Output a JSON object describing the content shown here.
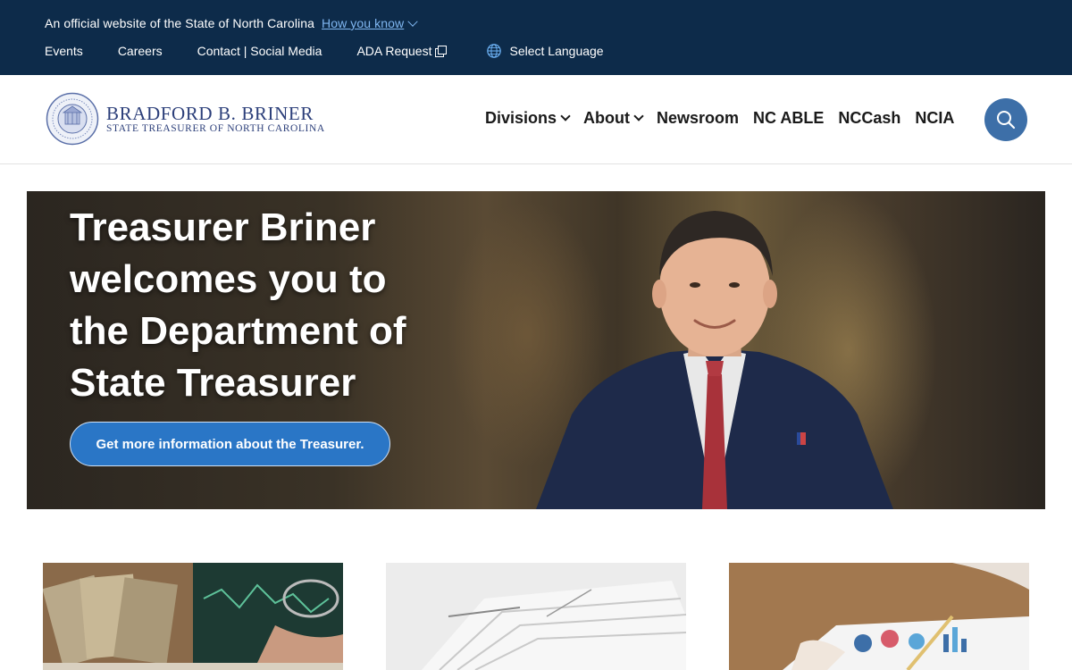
{
  "banner": {
    "official_text": "An official website of the State of North Carolina",
    "how_you_know": "How you know"
  },
  "utility_nav": {
    "items": [
      {
        "label": "Events"
      },
      {
        "label": "Careers"
      },
      {
        "label": "Contact | Social Media"
      },
      {
        "label": "ADA Request"
      }
    ],
    "language_label": "Select Language"
  },
  "header": {
    "logo_name": "BRADFORD B. BRINER",
    "logo_subtitle": "STATE TREASURER OF NORTH CAROLINA",
    "nav": [
      {
        "label": "Divisions",
        "has_dropdown": true
      },
      {
        "label": "About",
        "has_dropdown": true
      },
      {
        "label": "Newsroom",
        "has_dropdown": false
      },
      {
        "label": "NC ABLE",
        "has_dropdown": false
      },
      {
        "label": "NCCash",
        "has_dropdown": false
      },
      {
        "label": "NCIA",
        "has_dropdown": false
      }
    ],
    "search_icon": "search-icon"
  },
  "hero": {
    "title": "Treasurer Briner welcomes you to the Department of State Treasurer",
    "cta_label": "Get more information about the Treasurer."
  },
  "colors": {
    "top_bar": "#0d2b4a",
    "link_blue": "#7fb6f0",
    "logo_navy": "#2c3f7a",
    "search_button": "#3d6fa8",
    "cta_button": "#2a76c6"
  }
}
